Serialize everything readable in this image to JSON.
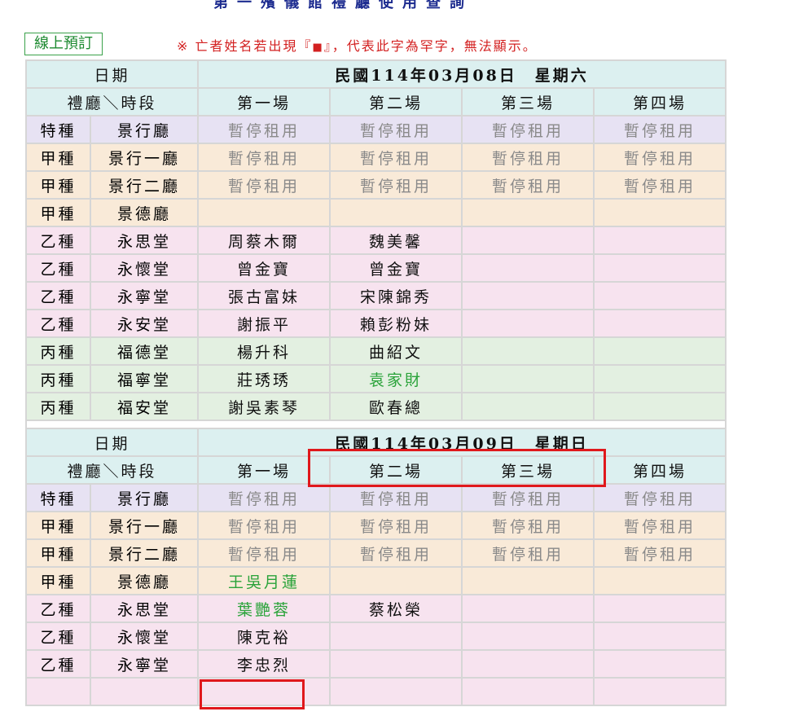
{
  "page": {
    "title": "第一殯儀館禮廳使用查詢",
    "booking_button": "線上預訂",
    "notice_prefix": "※ 亡者姓名若出現『",
    "notice_symbol": "■",
    "notice_suffix": "』，代表此字為罕字，無法顯示。"
  },
  "colors": {
    "accent_title": "#1c2b8f",
    "notice_red": "#d32020",
    "header_bg": "#dcf0f0",
    "type_special_bg": "#e7e2f3",
    "type_jia_bg": "#f9ead8",
    "type_yi_bg": "#f7e3ef",
    "type_bing_bg": "#e3f0e1",
    "highlight_box": "#e0181c"
  },
  "headers": {
    "date_label": "日期",
    "hall_slot": "禮廳＼時段",
    "sessions": [
      "第一場",
      "第二場",
      "第三場",
      "第四場"
    ]
  },
  "days": [
    {
      "date": "民國114年03月08日　星期六",
      "rows": [
        {
          "type": "特種",
          "hall": "景行廳",
          "style": "special",
          "s1": "暫停租用",
          "s2": "暫停租用",
          "s3": "暫停租用",
          "s4": "暫停租用",
          "paused": true
        },
        {
          "type": "甲種",
          "hall": "景行一廳",
          "style": "jia",
          "s1": "暫停租用",
          "s2": "暫停租用",
          "s3": "暫停租用",
          "s4": "暫停租用",
          "paused": true
        },
        {
          "type": "甲種",
          "hall": "景行二廳",
          "style": "jia",
          "s1": "暫停租用",
          "s2": "暫停租用",
          "s3": "暫停租用",
          "s4": "暫停租用",
          "paused": true
        },
        {
          "type": "甲種",
          "hall": "景德廳",
          "style": "jia",
          "s1": "",
          "s2": "",
          "s3": "",
          "s4": ""
        },
        {
          "type": "乙種",
          "hall": "永思堂",
          "style": "yi",
          "s1": "周蔡木爾",
          "s2": "魏美馨",
          "s3": "",
          "s4": ""
        },
        {
          "type": "乙種",
          "hall": "永懷堂",
          "style": "yi",
          "s1": "曾金寶",
          "s2": "曾金寶",
          "s3": "",
          "s4": ""
        },
        {
          "type": "乙種",
          "hall": "永寧堂",
          "style": "yi",
          "s1": "張古富妹",
          "s2": "宋陳錦秀",
          "s3": "",
          "s4": ""
        },
        {
          "type": "乙種",
          "hall": "永安堂",
          "style": "yi",
          "s1": "謝振平",
          "s2": "賴彭粉妹",
          "s3": "",
          "s4": ""
        },
        {
          "type": "丙種",
          "hall": "福德堂",
          "style": "bing",
          "s1": "楊升科",
          "s2": "曲紹文",
          "s3": "",
          "s4": ""
        },
        {
          "type": "丙種",
          "hall": "福寧堂",
          "style": "bing",
          "s1": "莊琇琇",
          "s2": "袁家財",
          "s2_green": true,
          "s3": "",
          "s4": ""
        },
        {
          "type": "丙種",
          "hall": "福安堂",
          "style": "bing",
          "s1": "謝吳素琴",
          "s2": "歐春總",
          "s3": "",
          "s4": ""
        }
      ]
    },
    {
      "date": "民國114年03月09日　星期日",
      "rows": [
        {
          "type": "特種",
          "hall": "景行廳",
          "style": "special",
          "s1": "暫停租用",
          "s2": "暫停租用",
          "s3": "暫停租用",
          "s4": "暫停租用",
          "paused": true
        },
        {
          "type": "甲種",
          "hall": "景行一廳",
          "style": "jia",
          "s1": "暫停租用",
          "s2": "暫停租用",
          "s3": "暫停租用",
          "s4": "暫停租用",
          "paused": true
        },
        {
          "type": "甲種",
          "hall": "景行二廳",
          "style": "jia",
          "s1": "暫停租用",
          "s2": "暫停租用",
          "s3": "暫停租用",
          "s4": "暫停租用",
          "paused": true
        },
        {
          "type": "甲種",
          "hall": "景德廳",
          "style": "jia",
          "s1": "王吳月蓮",
          "s1_green": true,
          "s2": "",
          "s3": "",
          "s4": ""
        },
        {
          "type": "乙種",
          "hall": "永思堂",
          "style": "yi",
          "s1": "葉艷蓉",
          "s1_green": true,
          "s2": "蔡松榮",
          "s3": "",
          "s4": ""
        },
        {
          "type": "乙種",
          "hall": "永懷堂",
          "style": "yi",
          "s1": "陳克裕",
          "s2": "",
          "s3": "",
          "s4": ""
        },
        {
          "type": "乙種",
          "hall": "永寧堂",
          "style": "yi",
          "s1": "李忠烈",
          "s2": "",
          "s3": "",
          "s4": ""
        },
        {
          "type": "",
          "hall": "",
          "style": "yi",
          "s1": "",
          "s2": "",
          "s3": "",
          "s4": ""
        }
      ]
    }
  ]
}
